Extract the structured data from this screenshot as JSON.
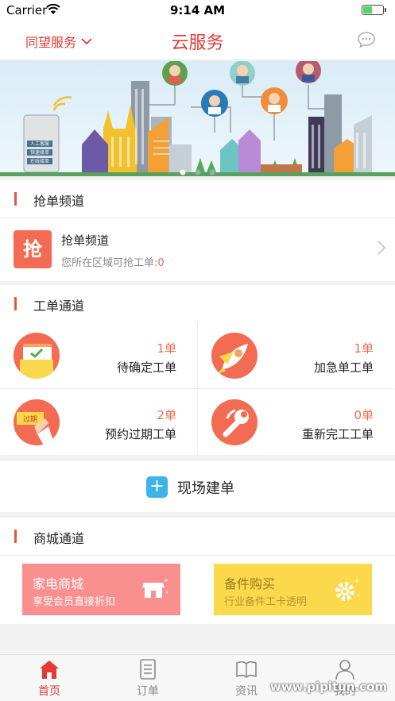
{
  "status_bar": {
    "carrier": "Carrier",
    "time": "9:14 AM"
  },
  "nav": {
    "location": "同望服务",
    "title": "云服务",
    "icons": {
      "location_dropdown": "chevron-down-icon",
      "message": "chat-bubble-icon"
    }
  },
  "banner": {
    "sign_lines": [
      "人工客服",
      "快速接单",
      "在线接单"
    ],
    "slides_total": 3,
    "active_slide": 1
  },
  "grab_section": {
    "header": "抢单频道",
    "item": {
      "icon_char": "抢",
      "title": "抢单频道",
      "sub_prefix": "您所在区域可抢工单:",
      "sub_count": "0"
    }
  },
  "work_section": {
    "header": "工单通道",
    "cells": [
      {
        "count": "1单",
        "name": "待确定工单",
        "icon": "calendar-check-icon"
      },
      {
        "count": "1单",
        "name": "加急单工单",
        "icon": "rocket-icon"
      },
      {
        "count": "2单",
        "name": "预约过期工单",
        "icon": "expired-tag-icon",
        "icon_text": "过期"
      },
      {
        "count": "0单",
        "name": "重新完工工单",
        "icon": "wrench-icon"
      }
    ]
  },
  "create": {
    "label": "现场建单",
    "icon": "plus-icon"
  },
  "mall_section": {
    "header": "商城通道",
    "cards": [
      {
        "title": "家电商城",
        "sub": "享受会员直接折扣",
        "icon": "shop-icon"
      },
      {
        "title": "备件购买",
        "sub": "行业备件工卡透明",
        "icon": "gear-icon"
      }
    ]
  },
  "tabs": [
    {
      "label": "首页",
      "icon": "home-icon",
      "active": true
    },
    {
      "label": "订单",
      "icon": "document-icon",
      "active": false
    },
    {
      "label": "资讯",
      "icon": "book-icon",
      "active": false
    },
    {
      "label": "我的",
      "icon": "user-icon",
      "active": false
    }
  ],
  "watermark": "www.pipitun.com",
  "colors": {
    "accent": "#e53935",
    "orange": "#f26b52",
    "blue": "#3cb4e8",
    "pink_card": "#fa8f8f",
    "yellow_card": "#fcd94c"
  }
}
